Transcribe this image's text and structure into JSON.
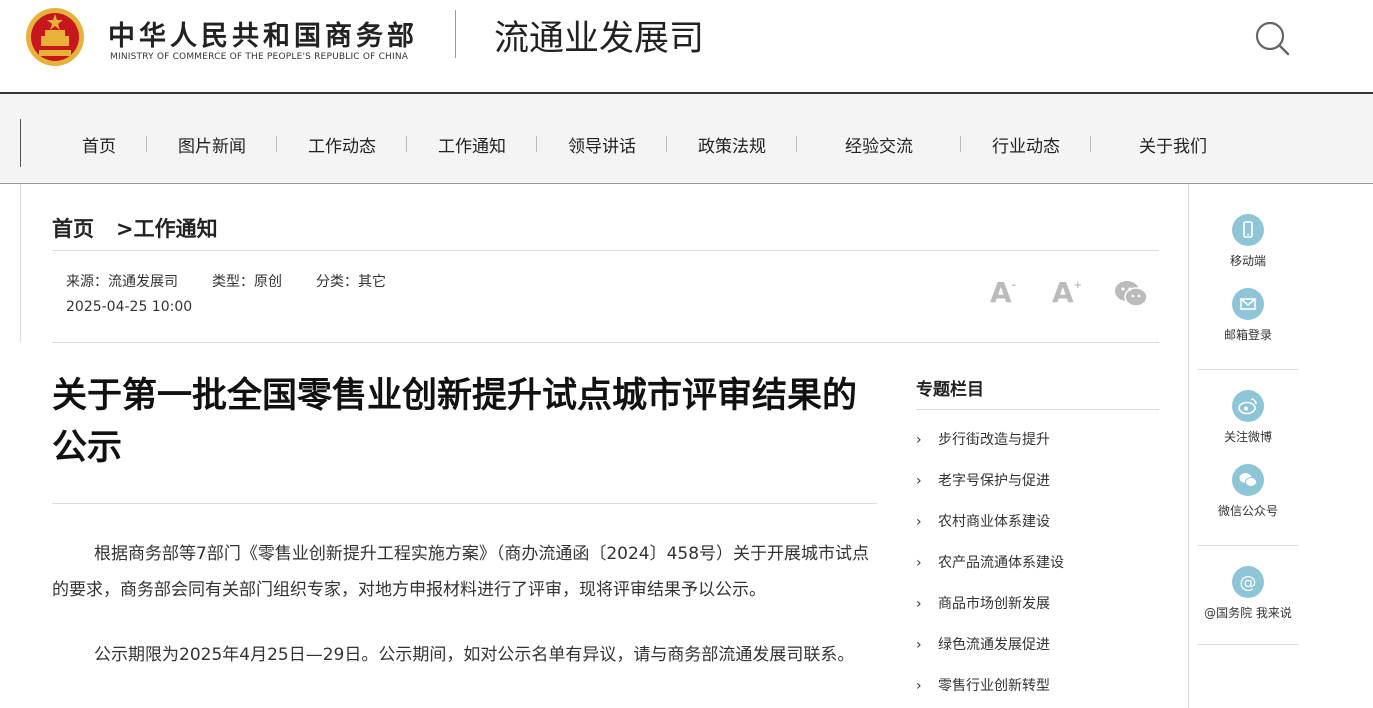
{
  "header": {
    "ministry_cn": "中华人民共和国商务部",
    "ministry_en": "MINISTRY OF COMMERCE OF THE PEOPLE'S REPUBLIC OF CHINA",
    "department": "流通业发展司",
    "search_icon": "search-icon",
    "brand_red": "#c8161d",
    "brand_gold": "#e8b23a"
  },
  "nav": {
    "items": [
      "首页",
      "图片新闻",
      "工作动态",
      "工作通知",
      "领导讲话",
      "政策法规",
      "经验交流",
      "行业动态",
      "关于我们"
    ]
  },
  "breadcrumb": {
    "home": "首页",
    "separator": ">",
    "current": "工作通知"
  },
  "meta": {
    "source": "来源：流通发展司",
    "type": "类型：原创",
    "category": "分类：其它",
    "datetime": "2025-04-25 10:00"
  },
  "tools": {
    "font_decrease": "A",
    "font_decrease_sup": "-",
    "font_increase": "A",
    "font_increase_sup": "+",
    "share_icon": "wechat-icon"
  },
  "article": {
    "title": "关于第一批全国零售业创新提升试点城市评审结果的公示",
    "paragraphs": [
      "根据商务部等7部门《零售业创新提升工程实施方案》（商办流通函〔2024〕458号）关于开展城市试点的要求，商务部会同有关部门组织专家，对地方申报材料进行了评审，现将评审结果予以公示。",
      "公示期限为2025年4月25日—29日。公示期间，如对公示名单有异议，请与商务部流通发展司联系。"
    ]
  },
  "topics": {
    "title": "专题栏目",
    "arrow": "›",
    "items": [
      "步行街改造与提升",
      "老字号保护与促进",
      "农村商业体系建设",
      "农产品流通体系建设",
      "商品市场创新发展",
      "绿色流通发展促进",
      "零售行业创新转型"
    ]
  },
  "sidebar": {
    "accent_color": "#8ec6d8",
    "items": [
      {
        "label": "移动端",
        "icon": "mobile-icon"
      },
      {
        "label": "邮箱登录",
        "icon": "mail-icon"
      },
      {
        "label": "关注微博",
        "icon": "weibo-icon"
      },
      {
        "label": "微信公众号",
        "icon": "wechat-icon"
      },
      {
        "label": "@国务院 我来说",
        "icon": "at-icon"
      }
    ]
  }
}
